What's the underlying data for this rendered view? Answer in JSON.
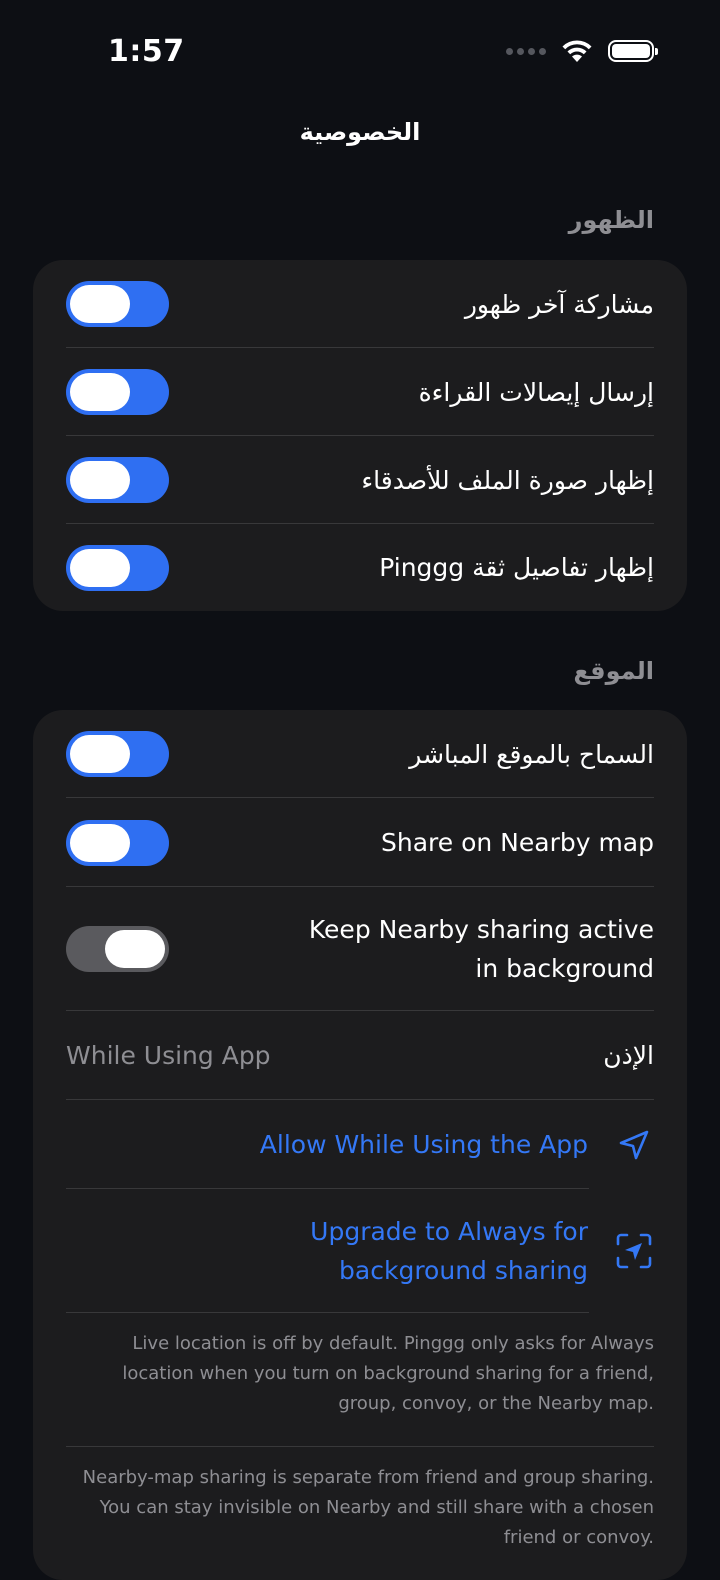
{
  "status_bar": {
    "time": "1:57"
  },
  "nav": {
    "title": "الخصوصية"
  },
  "visibility": {
    "header": "الظهور",
    "rows": [
      {
        "label": "مشاركة آخر ظهور",
        "on": true
      },
      {
        "label": "إرسال إيصالات القراءة",
        "on": true
      },
      {
        "label": "إظهار صورة الملف للأصدقاء",
        "on": true
      },
      {
        "label": "إظهار تفاصيل ثقة Pinggg",
        "on": true
      }
    ]
  },
  "location": {
    "header": "الموقع",
    "live_location": {
      "label": "السماح بالموقع المباشر",
      "on": true
    },
    "nearby_map": {
      "label": "Share on Nearby map",
      "on": true
    },
    "background": {
      "label_line1": "Keep Nearby sharing active",
      "label_line2": "in background",
      "on": false
    },
    "permission": {
      "label": "الإذن",
      "value": "While Using App"
    },
    "allow_link": "Allow While Using the App",
    "upgrade_link_line1": "Upgrade to Always for",
    "upgrade_link_line2": "background sharing",
    "footnote1_line1": "Live location is off by default. Pinggg only asks for Always",
    "footnote1_line2": "location when you turn on background sharing for a friend,",
    "footnote1_line3": "group, convoy, or the Nearby map.",
    "footnote2_line1": "Nearby-map sharing is separate from friend and group sharing.",
    "footnote2_line2": "You can stay invisible on Nearby and still share with a chosen",
    "footnote2_line3": "friend or convoy."
  },
  "colors": {
    "accent": "#2f6ff2",
    "link": "#3478f6",
    "card": "#1c1c1e",
    "background": "#0d0f14"
  }
}
